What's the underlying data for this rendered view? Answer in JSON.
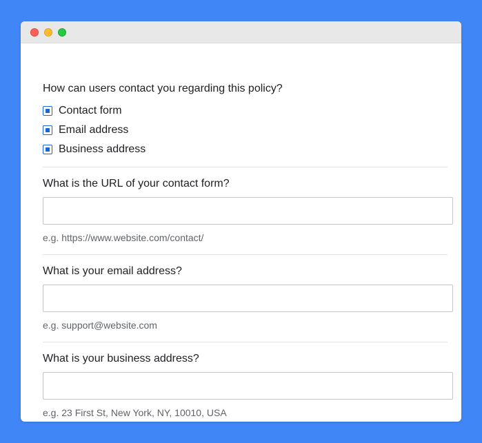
{
  "window": {
    "controls": [
      "close",
      "minimize",
      "maximize"
    ]
  },
  "contact_section": {
    "question": "How can users contact you regarding this policy?",
    "options": [
      {
        "label": "Contact form",
        "checked": true
      },
      {
        "label": "Email address",
        "checked": true
      },
      {
        "label": "Business address",
        "checked": true
      }
    ]
  },
  "contact_form_url": {
    "question": "What is the URL of your contact form?",
    "value": "",
    "hint": "e.g. https://www.website.com/contact/"
  },
  "email_address": {
    "question": "What is your email address?",
    "value": "",
    "hint": "e.g. support@website.com"
  },
  "business_address": {
    "question": "What is your business address?",
    "value": "",
    "hint": "e.g. 23 First St, New York, NY, 10010, USA"
  },
  "colors": {
    "background": "#4186f6",
    "checkbox_accent": "#1a66d2",
    "close": "#fe5f57",
    "minimize": "#febc2e",
    "maximize": "#28c840"
  }
}
